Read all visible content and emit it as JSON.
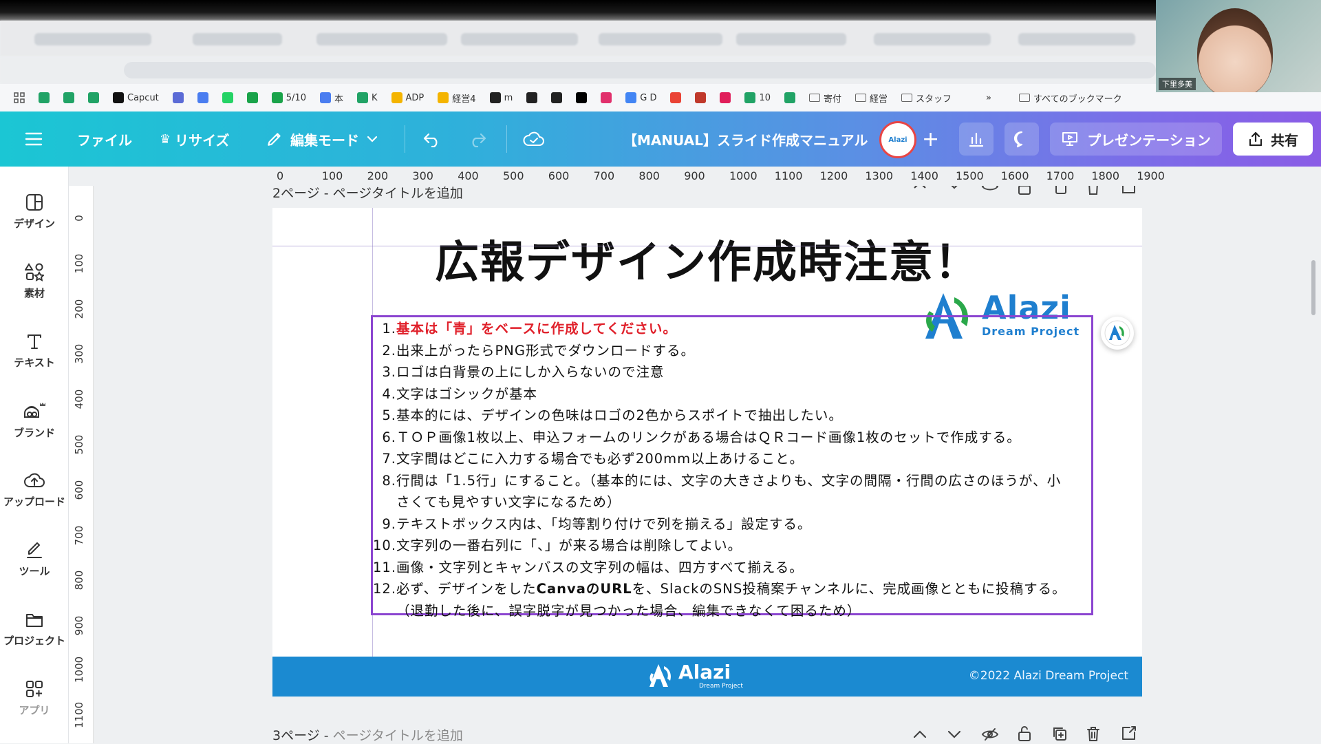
{
  "browser": {
    "bookmarks": [
      {
        "label": "",
        "color": "#21a366"
      },
      {
        "label": "",
        "color": "#21a366"
      },
      {
        "label": "",
        "color": "#21a366"
      },
      {
        "label": "Capcut",
        "color": "#111111"
      },
      {
        "label": "",
        "color": "#5b6bd6"
      },
      {
        "label": "",
        "color": "#4a7df0"
      },
      {
        "label": "",
        "color": "#25d366"
      },
      {
        "label": "",
        "color": "#1aa34a"
      },
      {
        "label": "5/10",
        "color": "#1aa34a"
      },
      {
        "label": "本",
        "color": "#4a7df0"
      },
      {
        "label": "K",
        "color": "#21a366"
      },
      {
        "label": "ADP",
        "color": "#f4b400"
      },
      {
        "label": "経営4",
        "color": "#f4b400"
      },
      {
        "label": "m",
        "color": "#222222"
      },
      {
        "label": "",
        "color": "#222222"
      },
      {
        "label": "",
        "color": "#222222"
      },
      {
        "label": "",
        "color": "#000000"
      },
      {
        "label": "",
        "color": "#e1306c"
      },
      {
        "label": "G D",
        "color": "#4285f4"
      },
      {
        "label": "",
        "color": "#ea4335"
      },
      {
        "label": "",
        "color": "#c0392b"
      },
      {
        "label": "",
        "color": "#e01e5a"
      },
      {
        "label": "10",
        "color": "#21a366"
      },
      {
        "label": "",
        "color": "#21a366"
      },
      {
        "label": "寄付",
        "color": "folder"
      },
      {
        "label": "経営",
        "color": "folder"
      },
      {
        "label": "スタッフ",
        "color": "folder"
      }
    ],
    "bookmarks_more": "»",
    "all_bookmarks": "すべてのブックマーク"
  },
  "webcam": {
    "name": "下里多美"
  },
  "topbar": {
    "menu_icon": "menu-icon",
    "file": "ファイル",
    "resize": "リサイズ",
    "edit_mode": "編集モード",
    "doc_title": "【MANUAL】スライド作成マニュアル",
    "avatar_label": "Alazi",
    "present": "プレゼンテーション",
    "share": "共有"
  },
  "sidebar": {
    "items": [
      {
        "label": "デザイン",
        "icon": "design-icon"
      },
      {
        "label": "素材",
        "icon": "elements-icon"
      },
      {
        "label": "テキスト",
        "icon": "text-icon"
      },
      {
        "label": "ブランド",
        "icon": "brand-icon"
      },
      {
        "label": "アップロード",
        "icon": "upload-icon"
      },
      {
        "label": "ツール",
        "icon": "tools-icon"
      },
      {
        "label": "プロジェクト",
        "icon": "projects-icon"
      },
      {
        "label": "アプリ",
        "icon": "apps-icon"
      }
    ]
  },
  "rulers": {
    "horizontal": [
      "0",
      "100",
      "200",
      "300",
      "400",
      "500",
      "600",
      "700",
      "800",
      "900",
      "1000",
      "1100",
      "1200",
      "1300",
      "1400",
      "1500",
      "1600",
      "1700",
      "1800",
      "1900"
    ],
    "vertical": [
      "0",
      "100",
      "200",
      "300",
      "400",
      "500",
      "600",
      "700",
      "800",
      "900",
      "1000",
      "1100"
    ]
  },
  "page2": {
    "label": "2ページ - ページタイトルを追加"
  },
  "page3": {
    "label": "3ページ",
    "sep": " - ",
    "sub": "ページタイトルを追加"
  },
  "slide": {
    "title": "広報デザイン作成時注意！",
    "logo_word": "Alazi",
    "logo_sub": "Dream Project",
    "lines": [
      {
        "num": "1.",
        "text": "基本は「青」をベースに作成してください。"
      },
      {
        "num": "2.",
        "text": "出来上がったらPNG形式でダウンロードする。"
      },
      {
        "num": "3.",
        "text": "ロゴは白背景の上にしか入らないので注意"
      },
      {
        "num": "4.",
        "text": "文字はゴシックが基本"
      },
      {
        "num": "5.",
        "text": "基本的には、デザインの色味はロゴの2色からスポイトで抽出したい。"
      },
      {
        "num": "6.",
        "text": "ＴＯＰ画像1枚以上、申込フォームのリンクがある場合はＱＲコード画像1枚のセットで作成する。"
      },
      {
        "num": "7.",
        "text": "文字間はどこに入力する場合でも必ず200mm以上あけること。"
      },
      {
        "num": "8.",
        "text": "行間は「1.5行」にすること。（基本的には、文字の大きさよりも、文字の間隔・行間の広さのほうが、小"
      },
      {
        "num": "",
        "text": "さくても見やすい文字になるため）"
      },
      {
        "num": "9.",
        "text": "テキストボックス内は、「均等割り付けで列を揃える」設定する。"
      },
      {
        "num": "10.",
        "text": "文字列の一番右列に「、」が来る場合は削除してよい。"
      },
      {
        "num": "11.",
        "text": "画像・文字列とキャンバスの文字列の幅は、四方すべて揃える。"
      },
      {
        "num": "12.",
        "pre": "必ず、デザインをした",
        "bold": "CanvaのURL",
        "post": "を、SlackのSNS投稿案チャンネルに、完成画像とともに投稿する。"
      },
      {
        "num": "",
        "text": "（退勤した後に、誤字脱字が見つかった場合、編集できなくて困るため）"
      }
    ],
    "footer_logo": "Alazi",
    "footer_logo_sub": "Dream Project",
    "copyright": "©2022 Alazi Dream Project"
  },
  "colors": {
    "accent_red": "#e0202a",
    "brand_blue": "#1b8ad1",
    "selection": "#8b45d0"
  }
}
